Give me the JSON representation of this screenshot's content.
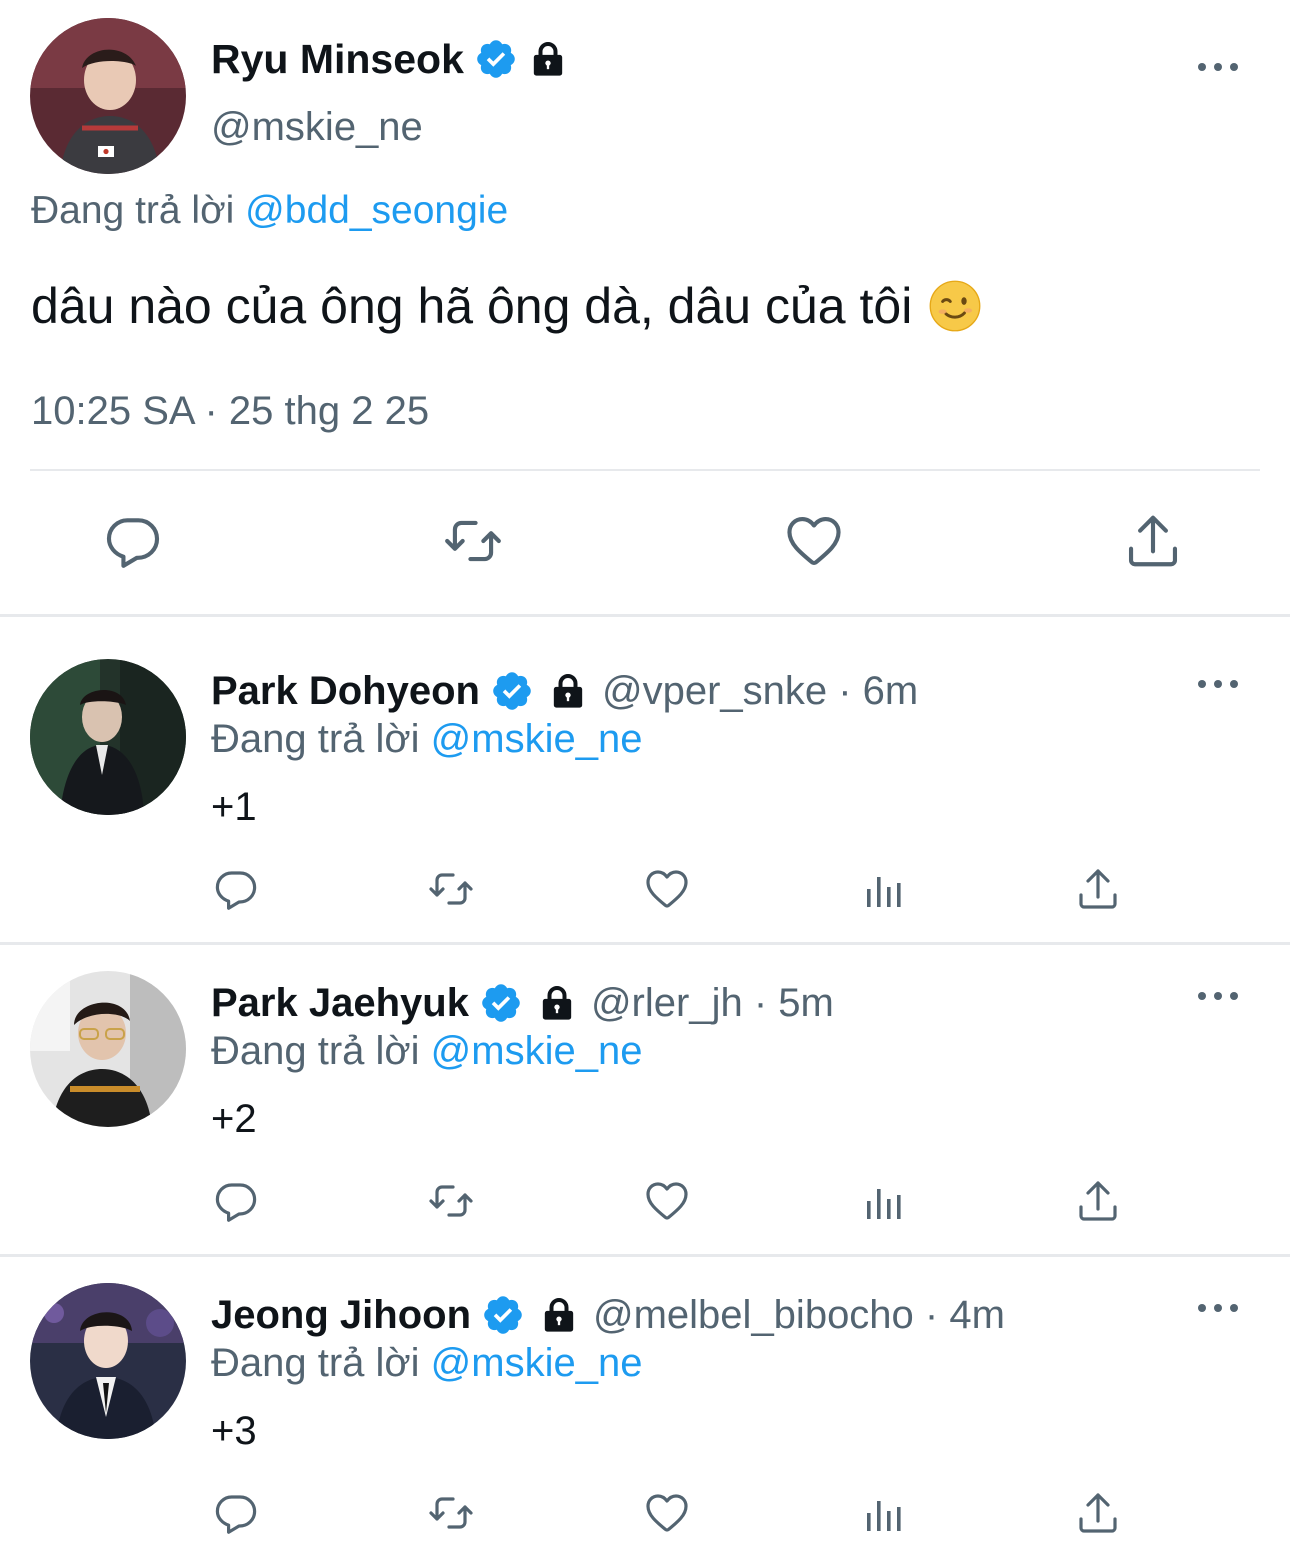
{
  "colors": {
    "accent": "#1d9bf0",
    "muted": "#536471",
    "text": "#0f1419",
    "divider": "#e7e9ec"
  },
  "main_tweet": {
    "name": "Ryu Minseok",
    "handle": "@mskie_ne",
    "reply_prefix": "Đang trả lời",
    "reply_to": "@bdd_seongie",
    "text": "dâu nào của ông hã ông dà, dâu của tôi",
    "emoji": "winking-face",
    "timestamp": "10:25 SA · 25 thg 2 25",
    "actions": [
      "reply-icon",
      "retweet-icon",
      "like-icon",
      "share-icon"
    ]
  },
  "replies": [
    {
      "name": "Park Dohyeon",
      "handle": "@vper_snke · 6m",
      "reply_prefix": "Đang trả lời",
      "reply_to": "@mskie_ne",
      "text": "+1"
    },
    {
      "name": "Park Jaehyuk",
      "handle": "@rler_jh · 5m",
      "reply_prefix": "Đang trả lời",
      "reply_to": "@mskie_ne",
      "text": "+2"
    },
    {
      "name": "Jeong Jihoon",
      "handle": "@melbel_bibocho · 4m",
      "reply_prefix": "Đang trả lời",
      "reply_to": "@mskie_ne",
      "text": "+3"
    }
  ],
  "reply_actions": [
    "reply-icon",
    "retweet-icon",
    "like-icon",
    "views-icon",
    "share-icon"
  ]
}
